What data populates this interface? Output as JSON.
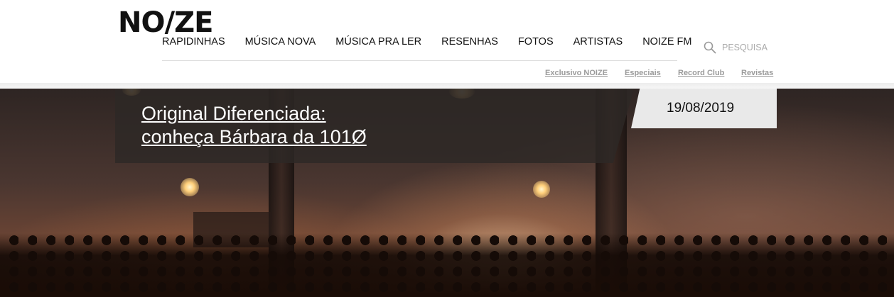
{
  "site": {
    "logo_text": "NO/ZE"
  },
  "nav": {
    "items": [
      {
        "label": "RAPIDINHAS"
      },
      {
        "label": "MÚSICA NOVA"
      },
      {
        "label": "MÚSICA PRA LER"
      },
      {
        "label": "RESENHAS"
      },
      {
        "label": "FOTOS"
      },
      {
        "label": "ARTISTAS"
      },
      {
        "label": "NOIZE FM"
      }
    ]
  },
  "search": {
    "placeholder": "PESQUISAR",
    "icon": "search-icon"
  },
  "subnav": {
    "items": [
      {
        "label": "Exclusivo NOIZE"
      },
      {
        "label": "Especiais"
      },
      {
        "label": "Record Club"
      },
      {
        "label": "Revistas"
      }
    ]
  },
  "hero": {
    "title_line1": "Original Diferenciada:",
    "title_line2": "conheça Bárbara da 101Ø",
    "date": "19/08/2019",
    "image_description_colors": {
      "overlay": "#2d2826",
      "date_bg": "#e9e9e9"
    }
  }
}
